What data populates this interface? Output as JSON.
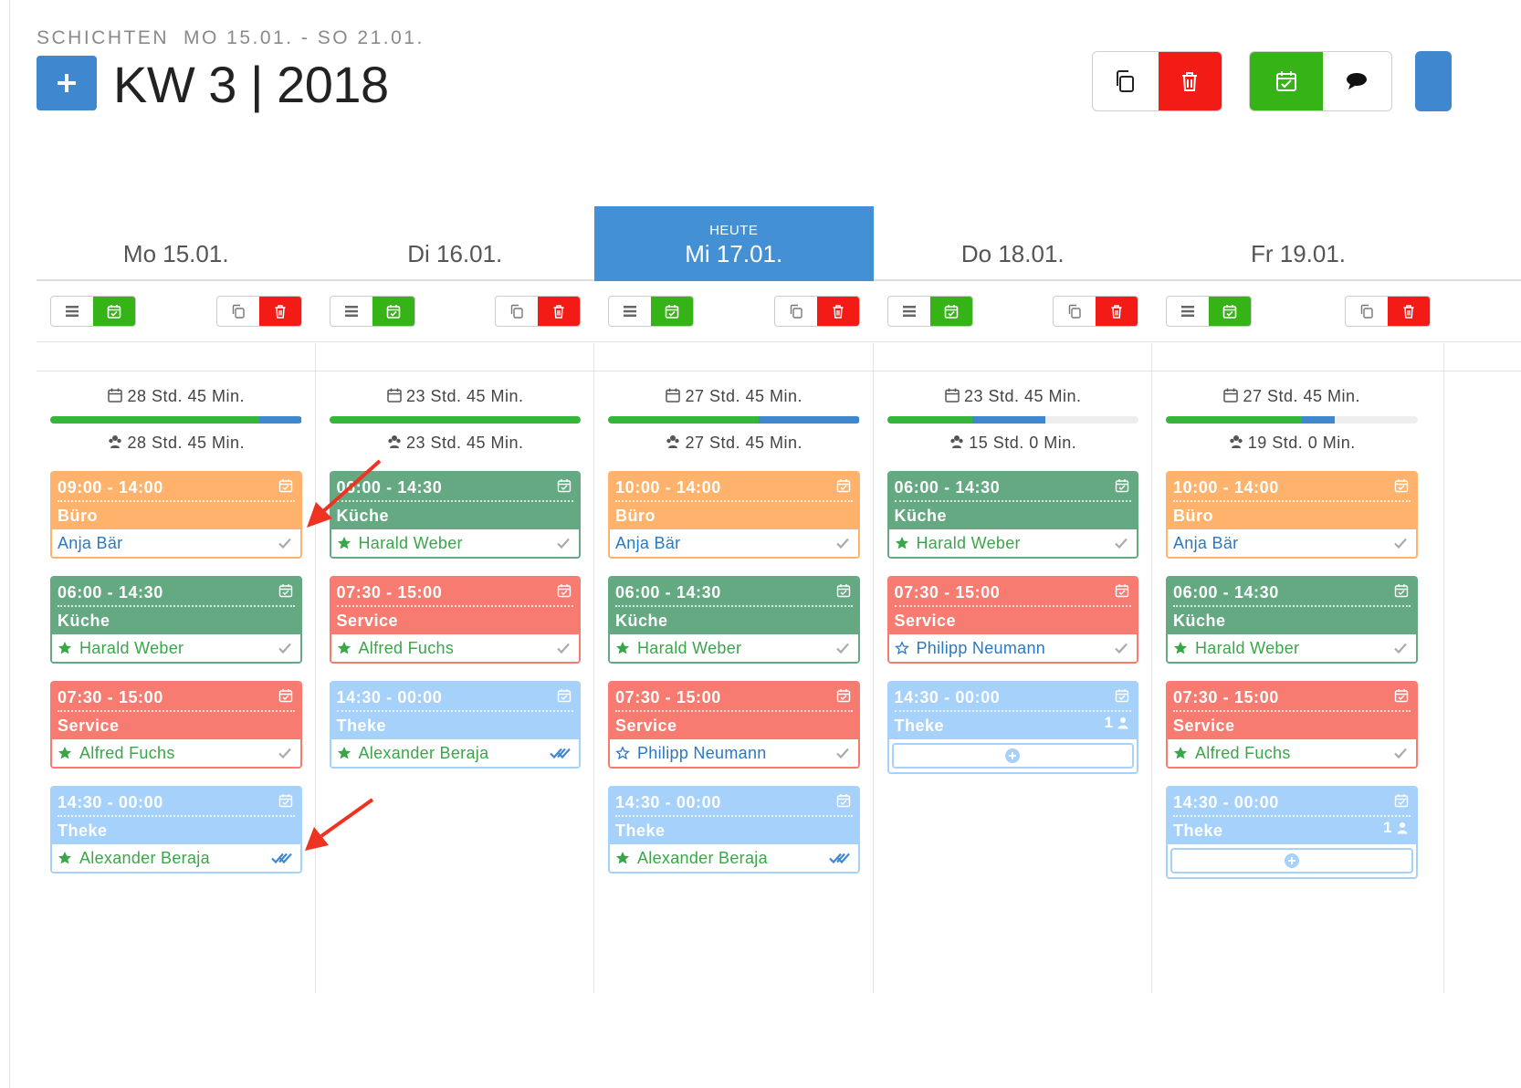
{
  "header": {
    "section": "SCHICHTEN",
    "range": "MO 15.01. - SO 21.01.",
    "title": "KW 3 | 2018",
    "add_icon": "plus-icon"
  },
  "toolbar": {
    "copy_icon": "copy-icon",
    "delete_icon": "trash-icon",
    "publish_icon": "calendar-check-icon",
    "comment_icon": "speech-bubble-icon"
  },
  "colors": {
    "primary": "#3f88cf",
    "danger": "#f21b16",
    "success": "#36b417",
    "orange": "#ffb26b",
    "green": "#64a982",
    "red": "#f77b70",
    "lightblue": "#a6d1fb"
  },
  "days": [
    {
      "date": "Mo 15.01.",
      "today_label": "",
      "planned": "28 Std. 45 Min.",
      "assigned": "28 Std. 45 Min.",
      "progress": {
        "green": 0.83,
        "blue": 0.17
      },
      "shifts": [
        {
          "time": "09:00 - 14:00",
          "role": "Büro",
          "color": "orange",
          "employee": "Anja Bär",
          "star": "none",
          "status": "check"
        },
        {
          "time": "06:00 - 14:30",
          "role": "Küche",
          "color": "green",
          "employee": "Harald Weber",
          "star": "filled",
          "status": "check"
        },
        {
          "time": "07:30 - 15:00",
          "role": "Service",
          "color": "red",
          "employee": "Alfred Fuchs",
          "star": "filled",
          "status": "check"
        },
        {
          "time": "14:30 - 00:00",
          "role": "Theke",
          "color": "blue",
          "employee": "Alexander Beraja",
          "star": "filled",
          "status": "double-check"
        }
      ]
    },
    {
      "date": "Di 16.01.",
      "today_label": "",
      "planned": "23 Std. 45 Min.",
      "assigned": "23 Std. 45 Min.",
      "progress": {
        "green": 1.0,
        "blue": 0.0
      },
      "shifts": [
        {
          "time": "06:00 - 14:30",
          "role": "Küche",
          "color": "green",
          "employee": "Harald Weber",
          "star": "filled",
          "status": "check"
        },
        {
          "time": "07:30 - 15:00",
          "role": "Service",
          "color": "red",
          "employee": "Alfred Fuchs",
          "star": "filled",
          "status": "check"
        },
        {
          "time": "14:30 - 00:00",
          "role": "Theke",
          "color": "blue",
          "employee": "Alexander Beraja",
          "star": "filled",
          "status": "double-check"
        }
      ]
    },
    {
      "date": "Mi 17.01.",
      "today_label": "HEUTE",
      "planned": "27 Std. 45 Min.",
      "assigned": "27 Std. 45 Min.",
      "progress": {
        "green": 0.6,
        "blue": 0.4
      },
      "shifts": [
        {
          "time": "10:00 - 14:00",
          "role": "Büro",
          "color": "orange",
          "employee": "Anja Bär",
          "star": "none",
          "status": "check"
        },
        {
          "time": "06:00 - 14:30",
          "role": "Küche",
          "color": "green",
          "employee": "Harald Weber",
          "star": "filled",
          "status": "check"
        },
        {
          "time": "07:30 - 15:00",
          "role": "Service",
          "color": "red",
          "employee": "Philipp Neumann",
          "star": "outline",
          "status": "check"
        },
        {
          "time": "14:30 - 00:00",
          "role": "Theke",
          "color": "blue",
          "employee": "Alexander Beraja",
          "star": "filled",
          "status": "double-check"
        }
      ]
    },
    {
      "date": "Do 18.01.",
      "today_label": "",
      "planned": "23 Std. 45 Min.",
      "assigned": "15 Std. 0 Min.",
      "progress": {
        "green": 0.34,
        "blue": 0.29
      },
      "shifts": [
        {
          "time": "06:00 - 14:30",
          "role": "Küche",
          "color": "green",
          "employee": "Harald Weber",
          "star": "filled",
          "status": "check"
        },
        {
          "time": "07:30 - 15:00",
          "role": "Service",
          "color": "red",
          "employee": "Philipp Neumann",
          "star": "outline",
          "status": "check"
        },
        {
          "time": "14:30 - 00:00",
          "role": "Theke",
          "color": "blue",
          "employee": "",
          "open_slots": "1",
          "star": "none",
          "status": "open"
        }
      ]
    },
    {
      "date": "Fr 19.01.",
      "today_label": "",
      "planned": "27 Std. 45 Min.",
      "assigned": "19 Std. 0 Min.",
      "progress": {
        "green": 0.54,
        "blue": 0.13
      },
      "shifts": [
        {
          "time": "10:00 - 14:00",
          "role": "Büro",
          "color": "orange",
          "employee": "Anja Bär",
          "star": "none",
          "status": "check"
        },
        {
          "time": "06:00 - 14:30",
          "role": "Küche",
          "color": "green",
          "employee": "Harald Weber",
          "star": "filled",
          "status": "check"
        },
        {
          "time": "07:30 - 15:00",
          "role": "Service",
          "color": "red",
          "employee": "Alfred Fuchs",
          "star": "filled",
          "status": "check"
        },
        {
          "time": "14:30 - 00:00",
          "role": "Theke",
          "color": "blue",
          "employee": "",
          "open_slots": "1",
          "star": "none",
          "status": "open"
        }
      ]
    }
  ]
}
